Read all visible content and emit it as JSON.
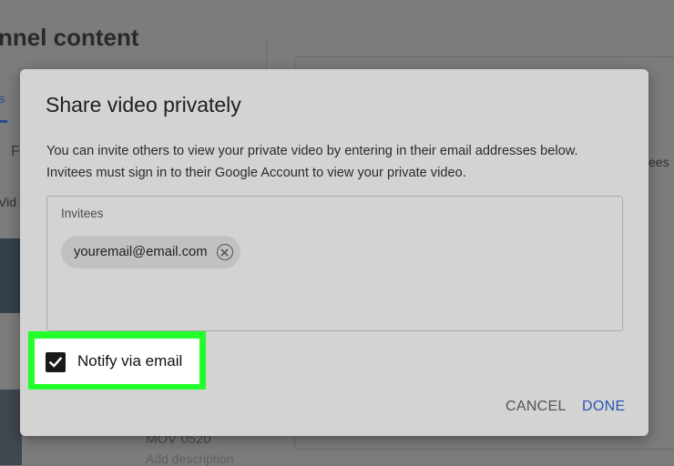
{
  "background": {
    "page_title": "nnel content",
    "tab_fragment": "s",
    "filter_fragment": "F",
    "column_fragment": "Vid",
    "right_fragment": "ees",
    "video_name": "MOV 0520",
    "video_description": "Add description"
  },
  "dialog": {
    "title": "Share video privately",
    "description_line1": "You can invite others to view your private video by entering in their email addresses below.",
    "description_line2": "Invitees must sign in to their Google Account to view your private video.",
    "invitees_label": "Invitees",
    "invitee_chip": "youremail@email.com",
    "notify_label": "Notify via email",
    "notify_checked": true,
    "cancel_label": "CANCEL",
    "done_label": "DONE"
  },
  "colors": {
    "highlight": "#22ff2b",
    "done_button": "#2b56b3",
    "dialog_background": "#d3d3d3"
  },
  "icons": {
    "chip_remove": "close-circle-icon",
    "checkbox": "checkmark-icon"
  }
}
